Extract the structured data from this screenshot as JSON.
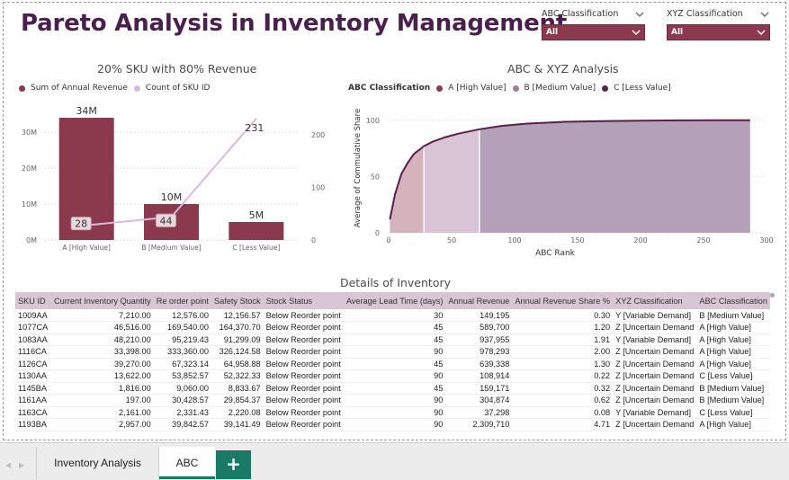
{
  "report": {
    "title": "Pareto Analysis in Inventory Management"
  },
  "slicers": [
    {
      "label": "ABC Classification",
      "value": "All"
    },
    {
      "label": "XYZ Classification",
      "value": "All"
    }
  ],
  "colors": {
    "primary": "#8b3a4e",
    "light_line": "#dcb8e0",
    "title": "#4b1f4d",
    "area_a": "#d4b3bd",
    "area_b": "#d9c4d4",
    "area_c": "#b4a0b8",
    "curve": "#5a1f4a",
    "accent_green": "#1a7a66",
    "header_bg": "#d9c5d3"
  },
  "pareto_chart": {
    "title": "20% SKU with 80% Revenue",
    "legend": [
      "Sum of Annual Revenue",
      "Count of SKU ID"
    ],
    "chart_data": {
      "type": "bar",
      "categories": [
        "A [High Value]",
        "B [Medium Value]",
        "C [Less Value]"
      ],
      "series": [
        {
          "name": "Sum of Annual Revenue",
          "values": [
            34,
            10,
            5
          ],
          "labels": [
            "34M",
            "10M",
            "5M"
          ]
        },
        {
          "name": "Count of SKU ID",
          "values": [
            28,
            44,
            231
          ],
          "labels": [
            "28",
            "44",
            "231"
          ]
        }
      ],
      "y_ticks": [
        "0M",
        "10M",
        "20M",
        "30M"
      ],
      "ylim": [
        0,
        38
      ],
      "y2_ticks": [
        "0",
        "100",
        "200"
      ],
      "y2lim": [
        0,
        260
      ]
    }
  },
  "abc_chart": {
    "title": "ABC & XYZ Analysis",
    "legend_title": "ABC Classification",
    "legend": [
      "A [High Value]",
      "B [Medium Value]",
      "C [Less Value]"
    ],
    "ylabel": "Average of Commulative Share",
    "xlabel": "ABC Rank",
    "chart_data": {
      "type": "area",
      "x_ticks": [
        "0",
        "50",
        "100",
        "150",
        "200",
        "250",
        "300"
      ],
      "y_ticks": [
        "0",
        "50",
        "100"
      ],
      "xlim": [
        0,
        300
      ],
      "ylim": [
        0,
        115
      ],
      "boundaries": [
        28,
        72,
        287
      ],
      "x": [
        1,
        5,
        10,
        15,
        20,
        28,
        35,
        45,
        55,
        72,
        90,
        110,
        140,
        170,
        200,
        230,
        260,
        287
      ],
      "y": [
        12,
        34,
        52,
        62,
        70,
        77,
        81,
        85,
        88,
        92,
        95,
        97,
        98.6,
        99.3,
        99.7,
        99.9,
        100,
        100
      ]
    }
  },
  "table": {
    "title": "Details of Inventory",
    "columns": [
      "SKU ID",
      "Current Inventory Quantity",
      "Re order point",
      "Safety Stock",
      "Stock Status",
      "Average Lead Time (days)",
      "Annual Revenue",
      "Annual Revenue Share %",
      "XYZ Classification",
      "ABC Classification"
    ],
    "rows": [
      [
        "1009AA",
        "7,210.00",
        "12,576.00",
        "12,156.57",
        "Below Reorder point",
        "30",
        "149,195",
        "0.30",
        "Y [Variable Demand]",
        "B [Medium Value]"
      ],
      [
        "1077CA",
        "46,516.00",
        "169,540.00",
        "164,370.70",
        "Below Reorder point",
        "45",
        "589,700",
        "1.20",
        "Z [Uncertain Demand",
        "A [High Value]"
      ],
      [
        "1083AA",
        "48,210.00",
        "95,219.43",
        "91,299.09",
        "Below Reorder point",
        "45",
        "937,955",
        "1.91",
        "Y [Variable Demand]",
        "A [High Value]"
      ],
      [
        "1116CA",
        "33,398.00",
        "333,360.00",
        "326,124.58",
        "Below Reorder point",
        "90",
        "978,293",
        "2.00",
        "Z [Uncertain Demand",
        "A [High Value]"
      ],
      [
        "1126CA",
        "39,270.00",
        "67,323.14",
        "64,958.88",
        "Below Reorder point",
        "45",
        "639,338",
        "1.30",
        "Z [Uncertain Demand",
        "A [High Value]"
      ],
      [
        "1130AA",
        "13,622.00",
        "53,852.57",
        "52,322.33",
        "Below Reorder point",
        "90",
        "108,914",
        "0.22",
        "Z [Uncertain Demand",
        "C [Less Value]"
      ],
      [
        "1145BA",
        "1,816.00",
        "9,060.00",
        "8,833.67",
        "Below Reorder point",
        "45",
        "159,171",
        "0.32",
        "Z [Uncertain Demand",
        "B [Medium Value]"
      ],
      [
        "1161AA",
        "197.00",
        "30,428.57",
        "29,854.37",
        "Below Reorder point",
        "90",
        "304,874",
        "0.62",
        "Z [Uncertain Demand",
        "B [Medium Value]"
      ],
      [
        "1163CA",
        "2,161.00",
        "2,331.43",
        "2,220.08",
        "Below Reorder point",
        "90",
        "37,298",
        "0.08",
        "Y [Variable Demand]",
        "C [Less Value]"
      ],
      [
        "1193BA",
        "2,957.00",
        "39,842.57",
        "39,141.49",
        "Below Reorder point",
        "90",
        "2,309,710",
        "4.71",
        "Z [Uncertain Demand",
        "A [High Value]"
      ]
    ]
  },
  "tabs": {
    "pages": [
      "Inventory Analysis",
      "ABC"
    ],
    "add_label": "+"
  }
}
